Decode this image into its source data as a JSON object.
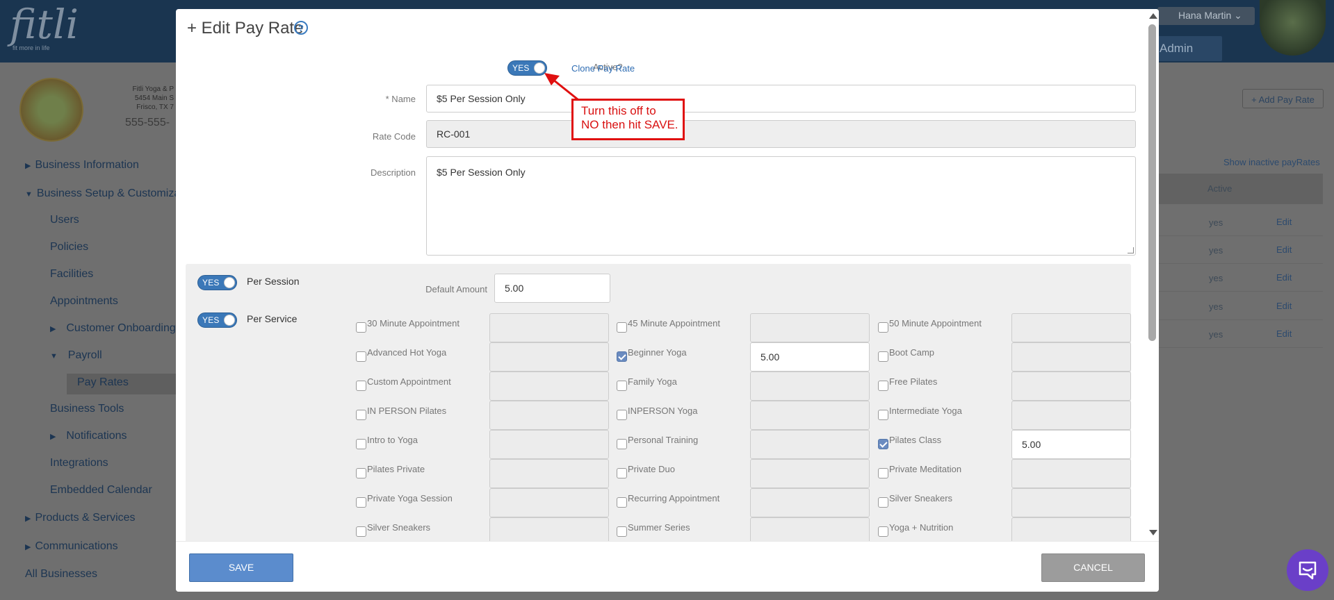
{
  "background": {
    "logo": "fitli",
    "logo_tagline": "fit more in life",
    "user_name": "Hana Martin",
    "admin_label": "Admin",
    "business_info": [
      "Fitli Yoga & P",
      "5454 Main S",
      "Frisco, TX 7"
    ],
    "business_phone": "555-555-",
    "nav": [
      {
        "label": "Business Information",
        "caret": "right"
      },
      {
        "label": "Business Setup & Customiza",
        "caret": "down"
      },
      {
        "label": "Users"
      },
      {
        "label": "Policies"
      },
      {
        "label": "Facilities"
      },
      {
        "label": "Appointments"
      },
      {
        "label": "Customer Onboarding",
        "caret": "right"
      },
      {
        "label": "Payroll",
        "caret": "down"
      },
      {
        "label": "Pay Rates"
      },
      {
        "label": "Business Tools"
      },
      {
        "label": "Notifications",
        "caret": "right"
      },
      {
        "label": "Integrations"
      },
      {
        "label": "Embedded Calendar"
      },
      {
        "label": "Products & Services",
        "caret": "right"
      },
      {
        "label": "Communications",
        "caret": "right"
      },
      {
        "label": "All Businesses"
      }
    ],
    "add_pay_rate": "+ Add Pay Rate",
    "show_inactive": "Show inactive payRates",
    "table_header_active": "Active",
    "rows": [
      {
        "active": "yes",
        "action": "Edit"
      },
      {
        "active": "yes",
        "action": "Edit"
      },
      {
        "active": "yes",
        "action": "Edit"
      },
      {
        "active": "yes",
        "action": "Edit"
      },
      {
        "active": "yes",
        "action": "Edit"
      }
    ]
  },
  "modal": {
    "title": "+ Edit Pay Rate",
    "help_glyph": "?",
    "active_label": "Active?",
    "active_toggle": "YES",
    "clone_link": "Clone Pay Rate",
    "name_label": "* Name",
    "name_value": "$5 Per Session Only",
    "rate_code_label": "Rate Code",
    "rate_code_value": "RC-001",
    "description_label": "Description",
    "description_value": "$5 Per Session Only",
    "callout": [
      "Turn this off to",
      "NO then hit SAVE."
    ],
    "per_session": {
      "toggle": "YES",
      "label": "Per Session",
      "default_amount_label": "Default Amount",
      "default_amount": "5.00"
    },
    "per_service": {
      "toggle": "YES",
      "label": "Per Service"
    },
    "services": [
      [
        {
          "name": "30 Minute Appointment",
          "checked": false,
          "amount": ""
        },
        {
          "name": "45 Minute Appointment",
          "checked": false,
          "amount": ""
        },
        {
          "name": "50 Minute Appointment",
          "checked": false,
          "amount": ""
        }
      ],
      [
        {
          "name": "Advanced Hot Yoga",
          "checked": false,
          "amount": ""
        },
        {
          "name": "Beginner Yoga",
          "checked": true,
          "amount": "5.00"
        },
        {
          "name": "Boot Camp",
          "checked": false,
          "amount": ""
        }
      ],
      [
        {
          "name": "Custom Appointment",
          "checked": false,
          "amount": ""
        },
        {
          "name": "Family Yoga",
          "checked": false,
          "amount": ""
        },
        {
          "name": "Free Pilates",
          "checked": false,
          "amount": ""
        }
      ],
      [
        {
          "name": "IN PERSON Pilates",
          "checked": false,
          "amount": ""
        },
        {
          "name": "INPERSON Yoga",
          "checked": false,
          "amount": ""
        },
        {
          "name": "Intermediate Yoga",
          "checked": false,
          "amount": ""
        }
      ],
      [
        {
          "name": "Intro to Yoga",
          "checked": false,
          "amount": ""
        },
        {
          "name": "Personal Training",
          "checked": false,
          "amount": ""
        },
        {
          "name": "Pilates Class",
          "checked": true,
          "amount": "5.00"
        }
      ],
      [
        {
          "name": "Pilates Private",
          "checked": false,
          "amount": ""
        },
        {
          "name": "Private Duo",
          "checked": false,
          "amount": ""
        },
        {
          "name": "Private Meditation",
          "checked": false,
          "amount": ""
        }
      ],
      [
        {
          "name": "Private Yoga Session",
          "checked": false,
          "amount": ""
        },
        {
          "name": "Recurring Appointment",
          "checked": false,
          "amount": ""
        },
        {
          "name": "Silver Sneakers",
          "checked": false,
          "amount": ""
        }
      ],
      [
        {
          "name": "Silver Sneakers",
          "checked": false,
          "amount": ""
        },
        {
          "name": "Summer Series",
          "checked": false,
          "amount": ""
        },
        {
          "name": "Yoga + Nutrition",
          "checked": false,
          "amount": ""
        }
      ]
    ],
    "save_label": "SAVE",
    "cancel_label": "CANCEL"
  },
  "colors": {
    "accent": "#3b78b8",
    "callout": "#e01010",
    "chat": "#6a3fc8"
  }
}
